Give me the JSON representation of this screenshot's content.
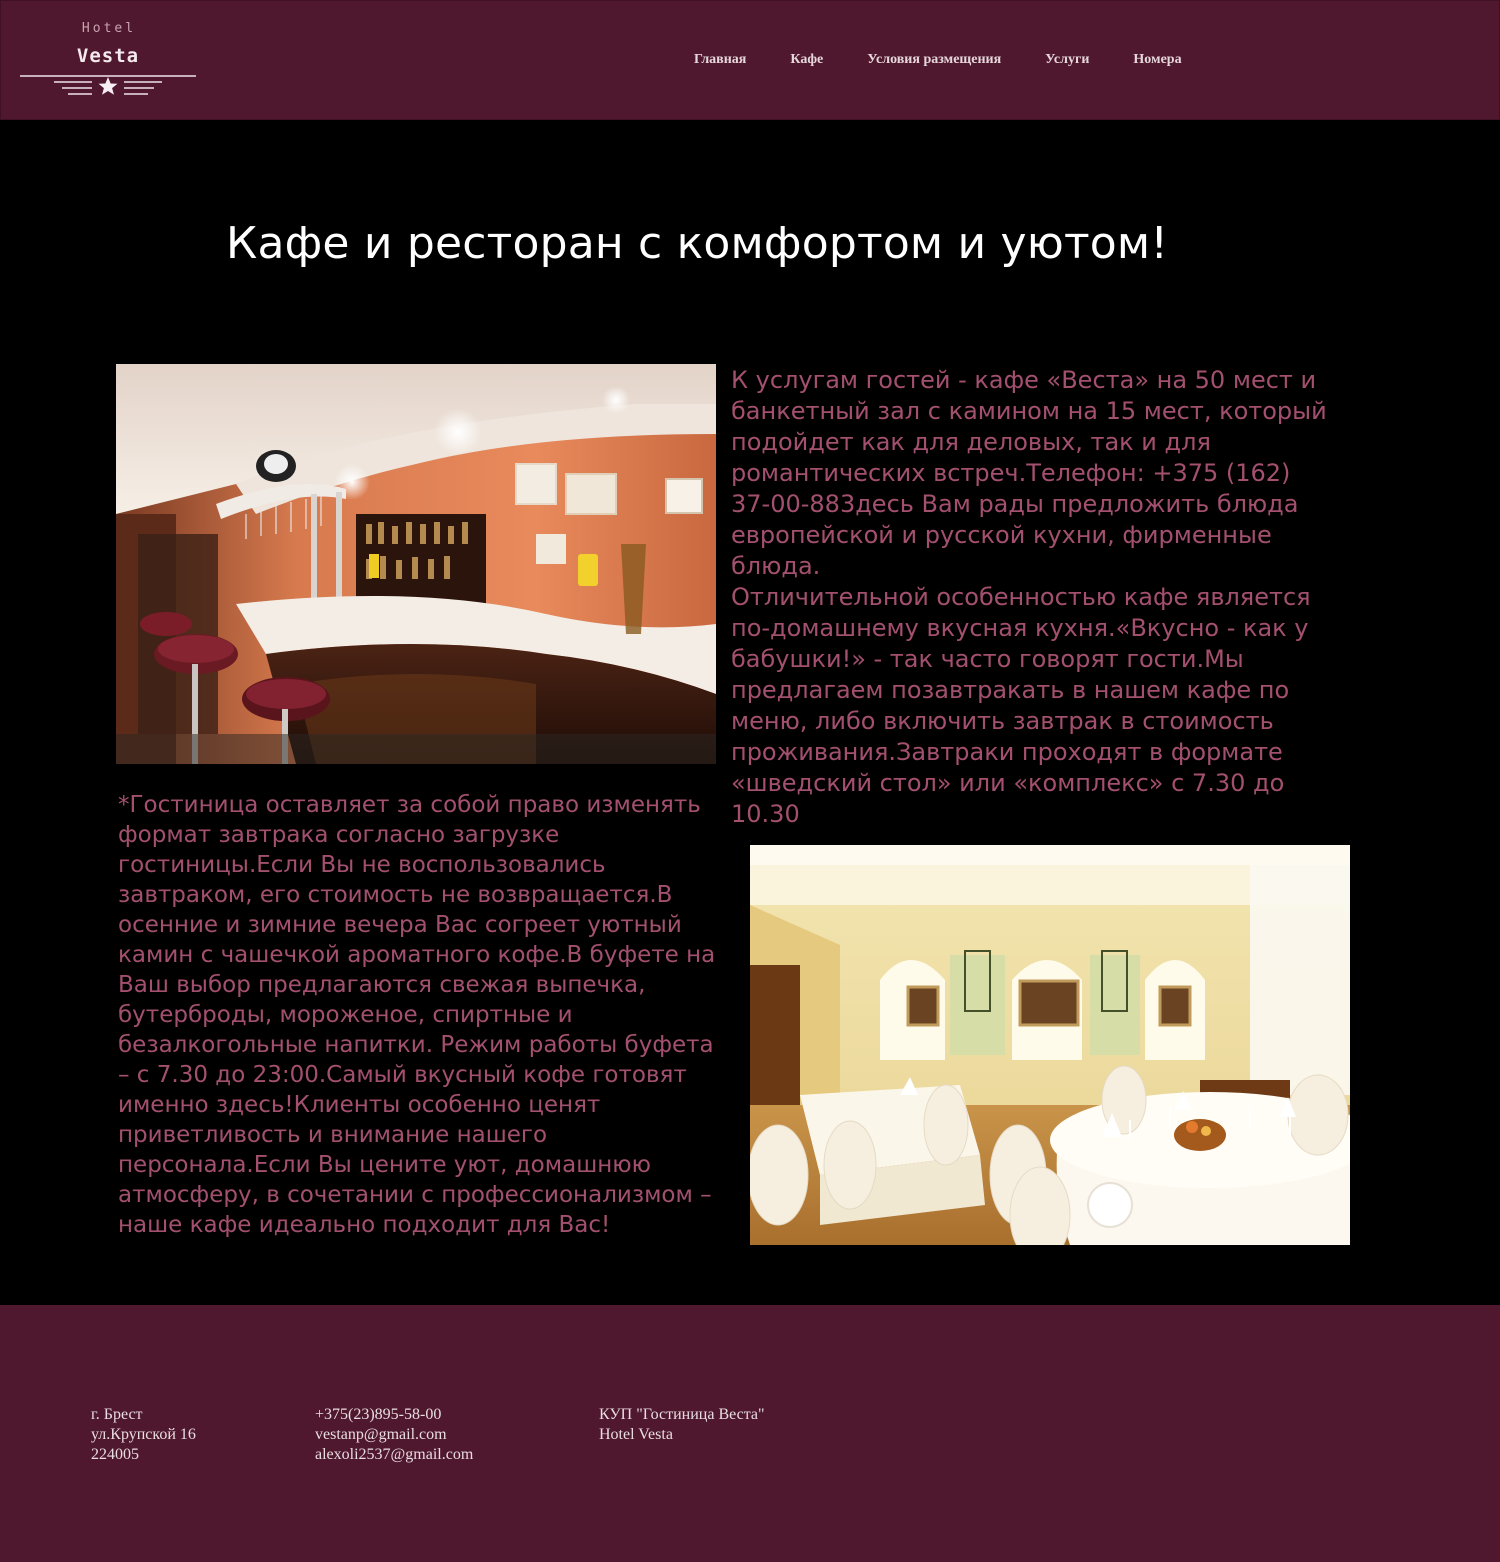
{
  "header": {
    "logo": {
      "small": "Hotel",
      "big": "Vesta"
    },
    "nav": [
      {
        "label": "Главная"
      },
      {
        "label": "Кафе"
      },
      {
        "label": "Условия размещения"
      },
      {
        "label": "Услуги"
      },
      {
        "label": "Номера"
      }
    ]
  },
  "main": {
    "title": "Кафе и ресторан с комфортом и уютом!",
    "text_right": "К услугам гостей - кафе «Веста» на 50 мест и банкетный зал с камином на 15 мест, который подойдет как для деловых, так и для романтических встреч.Телефон: +375 (162) 37-00-883десь Вам рады предложить блюда европейской и русской кухни, фирменные блюда.\nОтличительной особенностью кафе является по-домашнему вкусная кухня.«Вкусно - как у бабушки!» - так часто говорят гости.Мы предлагаем позавтракать в нашем кафе по меню, либо включить завтрак в стоимость проживания.Завтраки проходят в формате «шведский стол» или «комплекс» с 7.30 до 10.30",
    "text_left": "*Гостиница оставляет за собой право изменять формат завтрака согласно загрузке гостиницы.Если Вы не воспользовались завтраком, его стоимость не возвращается.В осенние и зимние вечера Вас согреет уютный камин с чашечкой ароматного кофе.В буфете на Ваш выбор предлагаются свежая выпечка, бутерброды, мороженое, спиртные и безалкогольные напитки. Режим работы буфета – с 7.30 до 23:00.Самый вкусный кофе готовят именно здесь!Клиенты особенно ценят приветливость и внимание нашего персонала.Если Вы цените уют, домашнюю атмосферу, в сочетании с профессионализмом – наше кафе идеально подходит для Вас!"
  },
  "footer": {
    "address": [
      "г. Брест",
      "ул.Крупской 16",
      "224005"
    ],
    "contacts": [
      "+375(23)895-58-00",
      "vestanp@gmail.com",
      "alexoli2537@gmail.com"
    ],
    "company": [
      "КУП \"Гостиница Веста\"",
      "Hotel Vesta"
    ]
  },
  "colors": {
    "header_bg": "#50182e",
    "body_bg": "#000000",
    "text_accent": "#a3506e",
    "title": "#ffffff"
  }
}
